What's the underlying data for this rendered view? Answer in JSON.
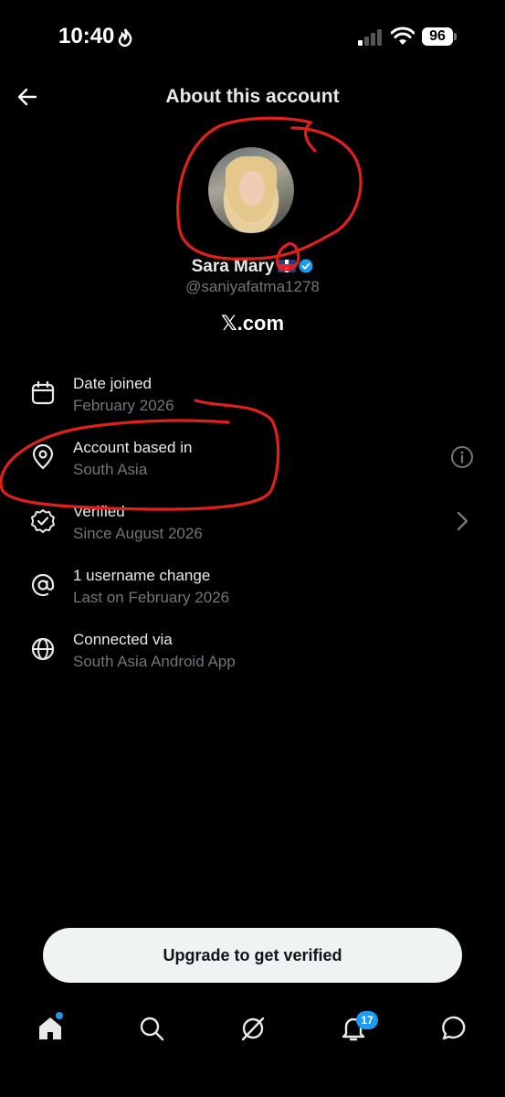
{
  "status_bar": {
    "time": "10:40",
    "battery": "96"
  },
  "header": {
    "title": "About this account"
  },
  "profile": {
    "name": "Sara Mary",
    "handle": "@saniyafatma1278",
    "site": "𝕏.com"
  },
  "details": [
    {
      "icon": "calendar-icon",
      "title": "Date joined",
      "sub": "February 2026"
    },
    {
      "icon": "location-pin-icon",
      "title": "Account based in",
      "sub": "South Asia",
      "right_icon": "info-icon"
    },
    {
      "icon": "verified-check-icon",
      "title": "Verified",
      "sub": "Since August 2026",
      "right_icon": "chevron-right-icon"
    },
    {
      "icon": "at-sign-icon",
      "title": "1 username change",
      "sub": "Last on February 2026"
    },
    {
      "icon": "globe-icon",
      "title": "Connected via",
      "sub": "South Asia Android App"
    }
  ],
  "upgrade": {
    "label": "Upgrade to get verified"
  },
  "nav": {
    "notifications_count": "17"
  },
  "colors": {
    "accent": "#1d9bf0",
    "annotation": "#e0201b",
    "muted": "#71767b"
  }
}
